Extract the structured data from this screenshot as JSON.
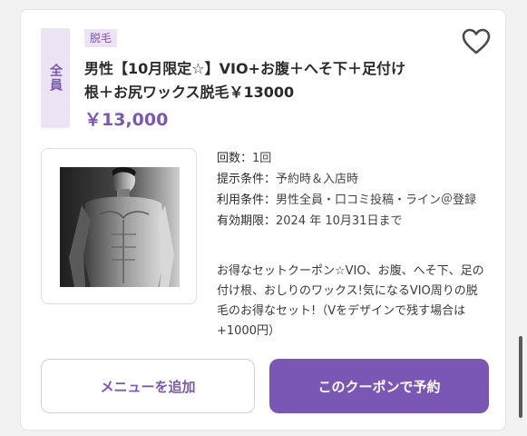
{
  "coupon": {
    "target_label": "全員",
    "category_label": "脱毛",
    "title": "男性【10月限定☆】VIO+お腹＋へそ下＋足付け根＋お尻ワックス脱毛￥13000",
    "price": "￥13,000",
    "favorite_icon": "heart-outline-icon",
    "details": [
      {
        "key": "回数：",
        "value": "1回"
      },
      {
        "key": "提示条件：",
        "value": "予約時＆入店時"
      },
      {
        "key": "利用条件：",
        "value": "男性全員・口コミ投稿・ライン＠登録"
      },
      {
        "key": "有効期限：",
        "value": "2024 年 10月31日まで"
      }
    ],
    "description": "お得なセットクーポン☆VIO、お腹、へそ下、足の付け根、おしりのワックス!気になるVIO周りの脱毛のお得なセット!（Vをデザインで残す場合は+1000円）"
  },
  "actions": {
    "add_menu_label": "メニューを追加",
    "book_label": "このクーポンで予約"
  },
  "colors": {
    "accent": "#7b57b5",
    "tag_background": "#ece3f5"
  }
}
